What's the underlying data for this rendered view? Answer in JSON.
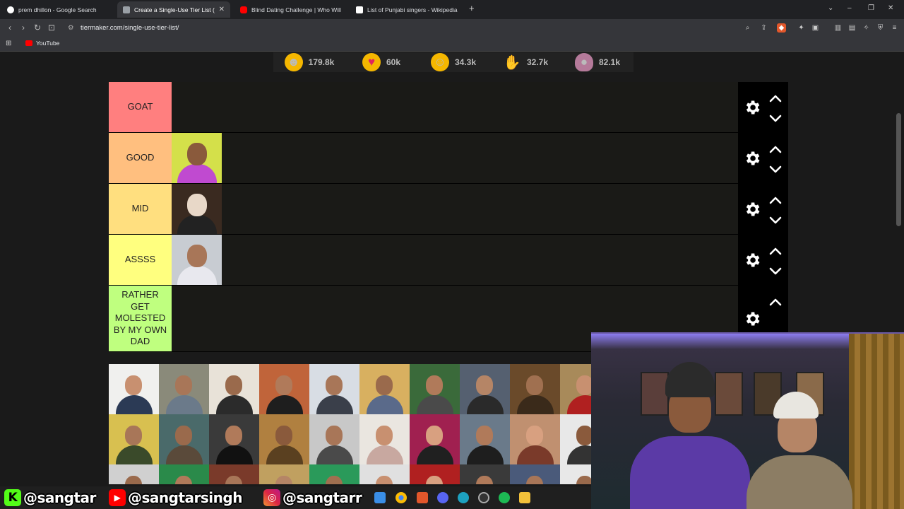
{
  "browser": {
    "tabs": [
      {
        "title": "prem dhillon - Google Search",
        "favicon_color": "#ffffff",
        "active": false
      },
      {
        "title": "Create a Single-Use Tier List (Pri",
        "favicon_color": "#9aa0a6",
        "active": true
      },
      {
        "title": "Blind Dating Challenge | Who Will Ki",
        "favicon_color": "#ff0000",
        "active": false
      },
      {
        "title": "List of Punjabi singers - Wikipedia",
        "favicon_color": "#ffffff",
        "active": false
      }
    ],
    "url": "tiermaker.com/single-use-tier-list/",
    "bookmark": "YouTube"
  },
  "reactions": [
    {
      "icon": "grinning-emoji",
      "count": "179.8k",
      "color": "#f5b700"
    },
    {
      "icon": "heart-eyes-emoji",
      "count": "60k",
      "color": "#f5b700"
    },
    {
      "icon": "laughing-emoji",
      "count": "34.3k",
      "color": "#f5b700"
    },
    {
      "icon": "raised-hands-emoji",
      "count": "32.7k",
      "color": "#f5b700"
    },
    {
      "icon": "poop-emoji",
      "count": "82.1k",
      "color": "#b57a9a"
    }
  ],
  "tiers": [
    {
      "label": "GOAT",
      "color": "#ff7f7f",
      "items": []
    },
    {
      "label": "GOOD",
      "color": "#ffbf7f",
      "items": [
        {
          "bg": "#d4e04a",
          "skin": "#8a5a3c",
          "shirt": "#c04ad0"
        }
      ]
    },
    {
      "label": "MID",
      "color": "#ffdf7f",
      "items": [
        {
          "bg": "#3a2a20",
          "skin": "#e8d8c8",
          "shirt": "#222222"
        }
      ]
    },
    {
      "label": "ASSSS",
      "color": "#ffff7f",
      "items": [
        {
          "bg": "#c8ccd2",
          "skin": "#a87658",
          "shirt": "#e8e8ee"
        }
      ]
    },
    {
      "label": "RATHER GET MOLESTED BY MY OWN DAD",
      "color": "#bfff7f",
      "items": []
    }
  ],
  "pool": [
    [
      {
        "bg": "#f0f0ee",
        "skin": "#c89070",
        "shirt": "#2b3a55"
      },
      {
        "bg": "#8a8a7a",
        "skin": "#a87658",
        "shirt": "#6b7a8a"
      },
      {
        "bg": "#e8e2d8",
        "skin": "#9a6a4c",
        "shirt": "#2b2b2b"
      },
      {
        "bg": "#c0643a",
        "skin": "#b07a5a",
        "shirt": "#1e1e1e"
      },
      {
        "bg": "#d8dde4",
        "skin": "#a87658",
        "shirt": "#3a3f4a"
      },
      {
        "bg": "#d8b060",
        "skin": "#9a6a4c",
        "shirt": "#5a6a8a"
      },
      {
        "bg": "#3a6a3a",
        "skin": "#b07a5a",
        "shirt": "#4a4a4a"
      },
      {
        "bg": "#556070",
        "skin": "#b58566",
        "shirt": "#2a2a2a"
      },
      {
        "bg": "#6a4a2a",
        "skin": "#a07050",
        "shirt": "#3a2a1a"
      },
      {
        "bg": "#a88a5a",
        "skin": "#c89070",
        "shirt": "#b02020"
      }
    ],
    [
      {
        "bg": "#d8c050",
        "skin": "#a87658",
        "shirt": "#3a4a2a"
      },
      {
        "bg": "#4a6a6a",
        "skin": "#9a6a4c",
        "shirt": "#5a4a3a"
      },
      {
        "bg": "#3a3a3a",
        "skin": "#b07a5a",
        "shirt": "#111111"
      },
      {
        "bg": "#b08040",
        "skin": "#8a5a3c",
        "shirt": "#5a4020"
      },
      {
        "bg": "#c8c8c8",
        "skin": "#a87658",
        "shirt": "#4a4a4a"
      },
      {
        "bg": "#eae6e0",
        "skin": "#c89070",
        "shirt": "#c8a8a0"
      },
      {
        "bg": "#a02050",
        "skin": "#d8a080",
        "shirt": "#202020"
      },
      {
        "bg": "#6a7a8a",
        "skin": "#b07a5a",
        "shirt": "#1e1e1e"
      },
      {
        "bg": "#c09070",
        "skin": "#d8a080",
        "shirt": "#7a3a2a"
      },
      {
        "bg": "#e8e8e8",
        "skin": "#8a5a3c",
        "shirt": "#333333"
      }
    ],
    [
      {
        "bg": "#d0d0d0",
        "skin": "#9a6a4c",
        "shirt": "#222222"
      },
      {
        "bg": "#2a8a4a",
        "skin": "#b07a5a",
        "shirt": "#1a1a1a"
      },
      {
        "bg": "#7a3a2a",
        "skin": "#a87658",
        "shirt": "#2a2a2a"
      },
      {
        "bg": "#c0a060",
        "skin": "#b58566",
        "shirt": "#3a3a3a"
      },
      {
        "bg": "#2a9a5a",
        "skin": "#a07050",
        "shirt": "#1a1a1a"
      },
      {
        "bg": "#e0e0e0",
        "skin": "#c89070",
        "shirt": "#e0e0e0"
      },
      {
        "bg": "#b02020",
        "skin": "#d8a080",
        "shirt": "#2a2a2a"
      },
      {
        "bg": "#3a3a3a",
        "skin": "#b07a5a",
        "shirt": "#d02020"
      },
      {
        "bg": "#4a5a7a",
        "skin": "#a87658",
        "shirt": "#2a2a2a"
      },
      {
        "bg": "#e8e8e8",
        "skin": "#9a6a4c",
        "shirt": "#444444"
      }
    ]
  ],
  "overlay": {
    "kick": "@sangtar",
    "youtube": "@sangtarsingh",
    "instagram": "@sangtarr"
  }
}
